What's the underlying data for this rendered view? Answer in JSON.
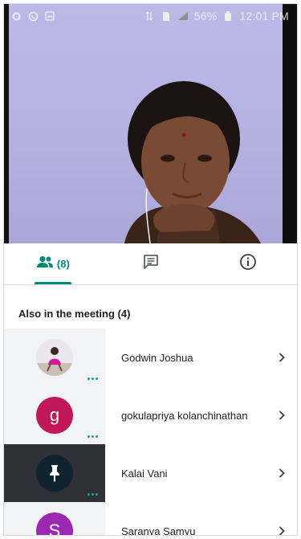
{
  "status_bar": {
    "battery": "56%",
    "time": "12:01 PM"
  },
  "tabs": [
    {
      "icon": "people-icon",
      "count": "(8)",
      "active": true
    },
    {
      "icon": "chat-icon",
      "active": false
    },
    {
      "icon": "info-icon",
      "active": false
    }
  ],
  "section": {
    "title": "Also in the meeting (4)"
  },
  "participants": [
    {
      "name": "Godwin Joshua",
      "avatar_type": "photo",
      "avatar_letter": "",
      "avatar_color": "#d9d0df"
    },
    {
      "name": "gokulapriya kolanchinathan",
      "avatar_type": "letter",
      "avatar_letter": "g",
      "avatar_color": "#c2185b"
    },
    {
      "name": "Kalai Vani",
      "avatar_type": "pin",
      "avatar_letter": "",
      "avatar_color": "#0f2330"
    },
    {
      "name": "Saranya Samyu",
      "avatar_type": "letter",
      "avatar_letter": "S",
      "avatar_color": "#9c27b0"
    }
  ],
  "colors": {
    "accent": "#00897b",
    "video_wall": "#b9b5e3"
  }
}
